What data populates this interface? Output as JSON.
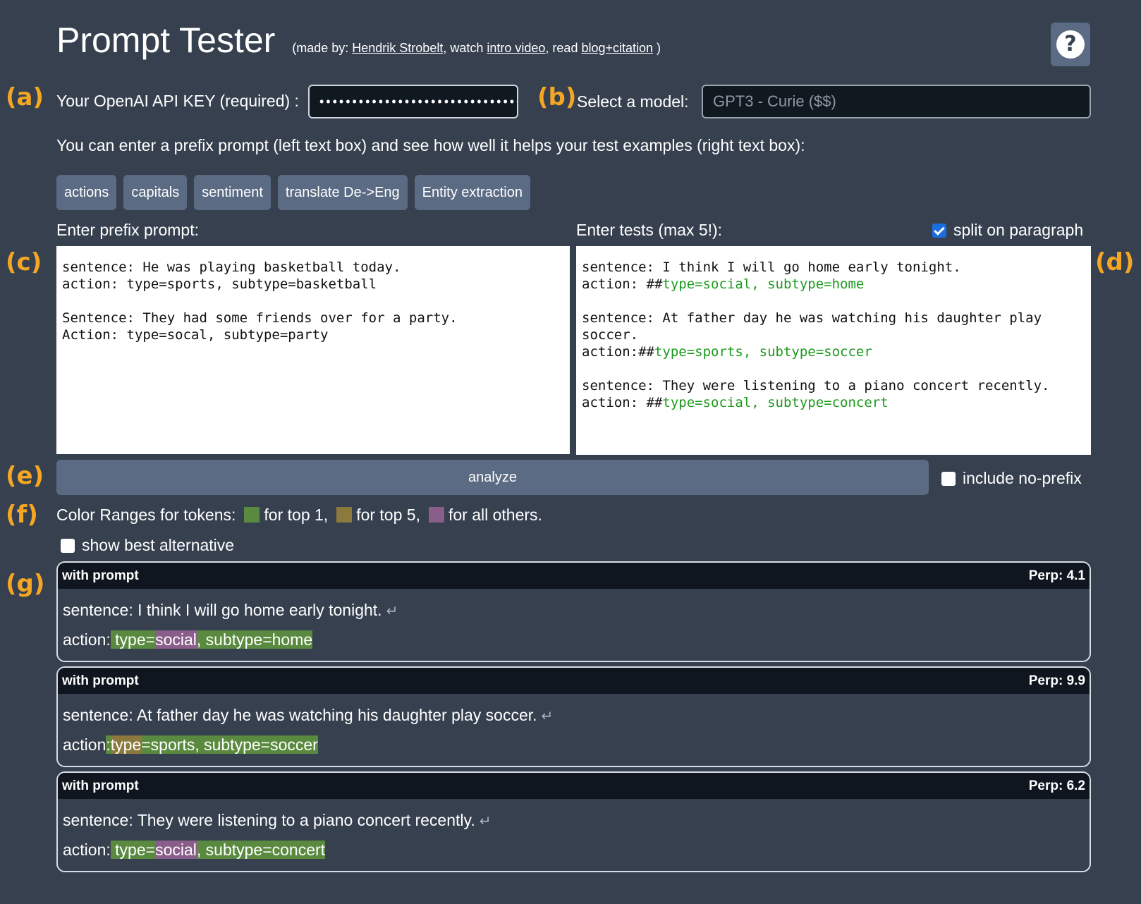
{
  "header": {
    "title": "Prompt Tester",
    "credits_prefix": "(made by: ",
    "author_link": "Hendrik Strobelt",
    "credits_mid1": ", watch ",
    "video_link": "intro video",
    "credits_mid2": ", read ",
    "blog_link": "blog+citation",
    "credits_suffix": " )",
    "help_symbol": "?"
  },
  "markers": {
    "a": "(a)",
    "b": "(b)",
    "c": "(c)",
    "d": "(d)",
    "e": "(e)",
    "f": "(f)",
    "g": "(g)"
  },
  "api": {
    "label": "Your OpenAI API KEY (required) :",
    "masked_value": "••••••••••••••••••••••••••••••••••"
  },
  "model": {
    "label": "Select a model:",
    "selected": "GPT3 - Curie ($$)"
  },
  "intro": "You can enter a prefix prompt (left text box) and see how well it helps your test examples (right text box):",
  "presets": [
    "actions",
    "capitals",
    "sentiment",
    "translate De->Eng",
    "Entity extraction"
  ],
  "prefix": {
    "label": "Enter prefix prompt:",
    "text": "sentence: He was playing basketball today.\naction: type=sports, subtype=basketball\n\nSentence: They had some friends over for a party.\nAction: type=socal, subtype=party"
  },
  "tests": {
    "label": "Enter tests (max 5!):",
    "split_label": "split on paragraph",
    "split_checked": true,
    "items": [
      {
        "sentence": "sentence: I think I will go home early tonight.",
        "action_prefix": "action: ##",
        "action_target": "type=social, subtype=home"
      },
      {
        "sentence": "sentence: At father day he was watching his daughter play soccer.",
        "action_prefix": "action:##",
        "action_target": "type=sports, subtype=soccer"
      },
      {
        "sentence": "sentence: They were listening to a piano concert recently.",
        "action_prefix": "action: ##",
        "action_target": "type=social, subtype=concert"
      }
    ]
  },
  "analyze": {
    "button_label": "analyze",
    "no_prefix_label": "include no-prefix",
    "no_prefix_checked": false
  },
  "colors": {
    "label": "Color Ranges for tokens:",
    "top1_label": "for top 1,",
    "top5_label": "for top 5,",
    "others_label": "for all others.",
    "top1_color": "#5a8a3f",
    "top5_color": "#8c7a3c",
    "others_color": "#8a5e8a"
  },
  "best_alt": {
    "label": "show best alternative",
    "checked": false
  },
  "results": [
    {
      "title": "with prompt",
      "perp": "Perp: 4.1",
      "sentence": "sentence: I think I will go home early tonight.",
      "action_label": "action:",
      "tokens": [
        {
          "t": " type=",
          "c": "top1"
        },
        {
          "t": "social",
          "c": "other"
        },
        {
          "t": ", subtype=home",
          "c": "top1"
        }
      ]
    },
    {
      "title": "with prompt",
      "perp": "Perp: 9.9",
      "sentence": "sentence: At father day he was watching his daughter play soccer.",
      "action_label": "action",
      "tokens": [
        {
          "t": ":",
          "c": "top1"
        },
        {
          "t": "type",
          "c": "top5"
        },
        {
          "t": "=sports, subtype=soccer",
          "c": "top1"
        }
      ]
    },
    {
      "title": "with prompt",
      "perp": "Perp: 6.2",
      "sentence": "sentence: They were listening to a piano concert recently.",
      "action_label": "action:",
      "tokens": [
        {
          "t": " type=",
          "c": "top1"
        },
        {
          "t": "social",
          "c": "other"
        },
        {
          "t": ", subtype=concert",
          "c": "top1"
        }
      ]
    }
  ],
  "icons": {
    "return": "return-arrow-icon",
    "help": "help-icon"
  }
}
